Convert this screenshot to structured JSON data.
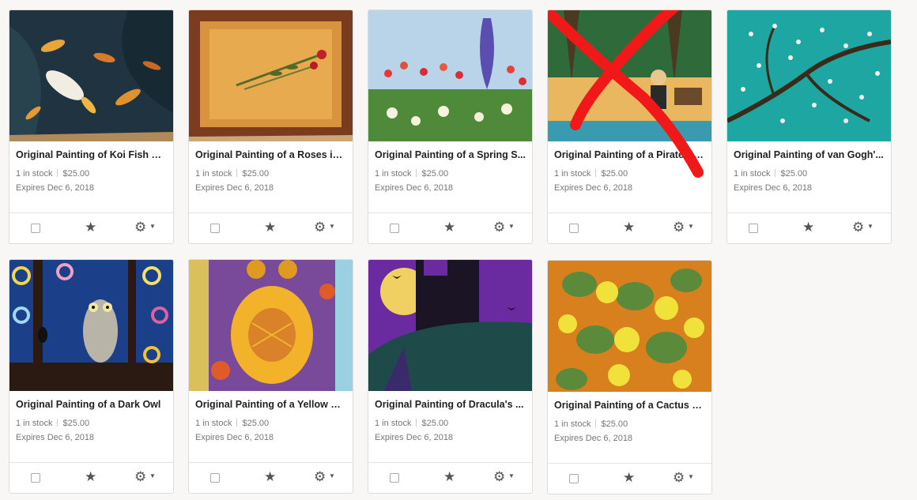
{
  "listings": [
    {
      "title": "Original Painting of Koi Fish Po...",
      "stock": "1 in stock",
      "price": "$25.00",
      "expires": "Expires Dec 6, 2018",
      "art": "koi"
    },
    {
      "title": "Original Painting of a Roses in ...",
      "stock": "1 in stock",
      "price": "$25.00",
      "expires": "Expires Dec 6, 2018",
      "art": "roses"
    },
    {
      "title": "Original Painting of a Spring S...",
      "stock": "1 in stock",
      "price": "$25.00",
      "expires": "Expires Dec 6, 2018",
      "art": "spring"
    },
    {
      "title": "Original Painting of a Pirate Ba...",
      "stock": "1 in stock",
      "price": "$25.00",
      "expires": "Expires Dec 6, 2018",
      "art": "pirate",
      "crossed_out": true
    },
    {
      "title": "Original Painting of van Gogh'...",
      "stock": "1 in stock",
      "price": "$25.00",
      "expires": "Expires Dec 6, 2018",
      "art": "almond"
    },
    {
      "title": "Original Painting of a Dark Owl",
      "stock": "1 in stock",
      "price": "$25.00",
      "expires": "Expires Dec 6, 2018",
      "art": "darkowl"
    },
    {
      "title": "Original Painting of a Yellow O...",
      "stock": "1 in stock",
      "price": "$25.00",
      "expires": "Expires Dec 6, 2018",
      "art": "yellowowl"
    },
    {
      "title": "Original Painting of Dracula's ...",
      "stock": "1 in stock",
      "price": "$25.00",
      "expires": "Expires Dec 6, 2018",
      "art": "dracula"
    },
    {
      "title": "Original Painting of a Cactus P...",
      "stock": "1 in stock",
      "price": "$25.00",
      "expires": "Expires Dec 6, 2018",
      "art": "cactus"
    }
  ],
  "icons": {
    "checkbox": "checkbox-icon",
    "star": "star-icon",
    "gear": "gear-icon",
    "caret": "caret-down-icon"
  },
  "colors": {
    "cross_mark": "#f01818",
    "text_primary": "#222222",
    "text_secondary": "#777777"
  }
}
